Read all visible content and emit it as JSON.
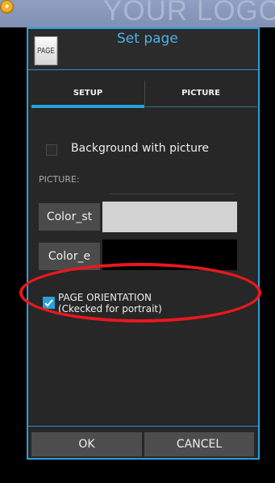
{
  "app": {
    "logo_text": "YOUR LOGO",
    "app_icon": "app-orange-circle-icon"
  },
  "dialog": {
    "icon_label": "PAGE",
    "title": "Set page"
  },
  "tabs": [
    {
      "label": "SETUP",
      "selected": true
    },
    {
      "label": "PICTURE",
      "selected": false
    }
  ],
  "setup": {
    "background_checkbox": {
      "label": "Background with picture",
      "checked": false
    },
    "picture_label": "PICTURE:",
    "color_start": {
      "label": "Color_st",
      "color": "#d2d2d2"
    },
    "color_end": {
      "label": "Color_e",
      "color": "#000000"
    },
    "orientation_checkbox": {
      "line1": "PAGE ORIENTATION",
      "line2": "(Ckecked for portrait)",
      "checked": true
    }
  },
  "buttons": {
    "ok": "OK",
    "cancel": "CANCEL"
  },
  "colors": {
    "accent": "#2aa0d8",
    "annotation": "#e8181e"
  }
}
